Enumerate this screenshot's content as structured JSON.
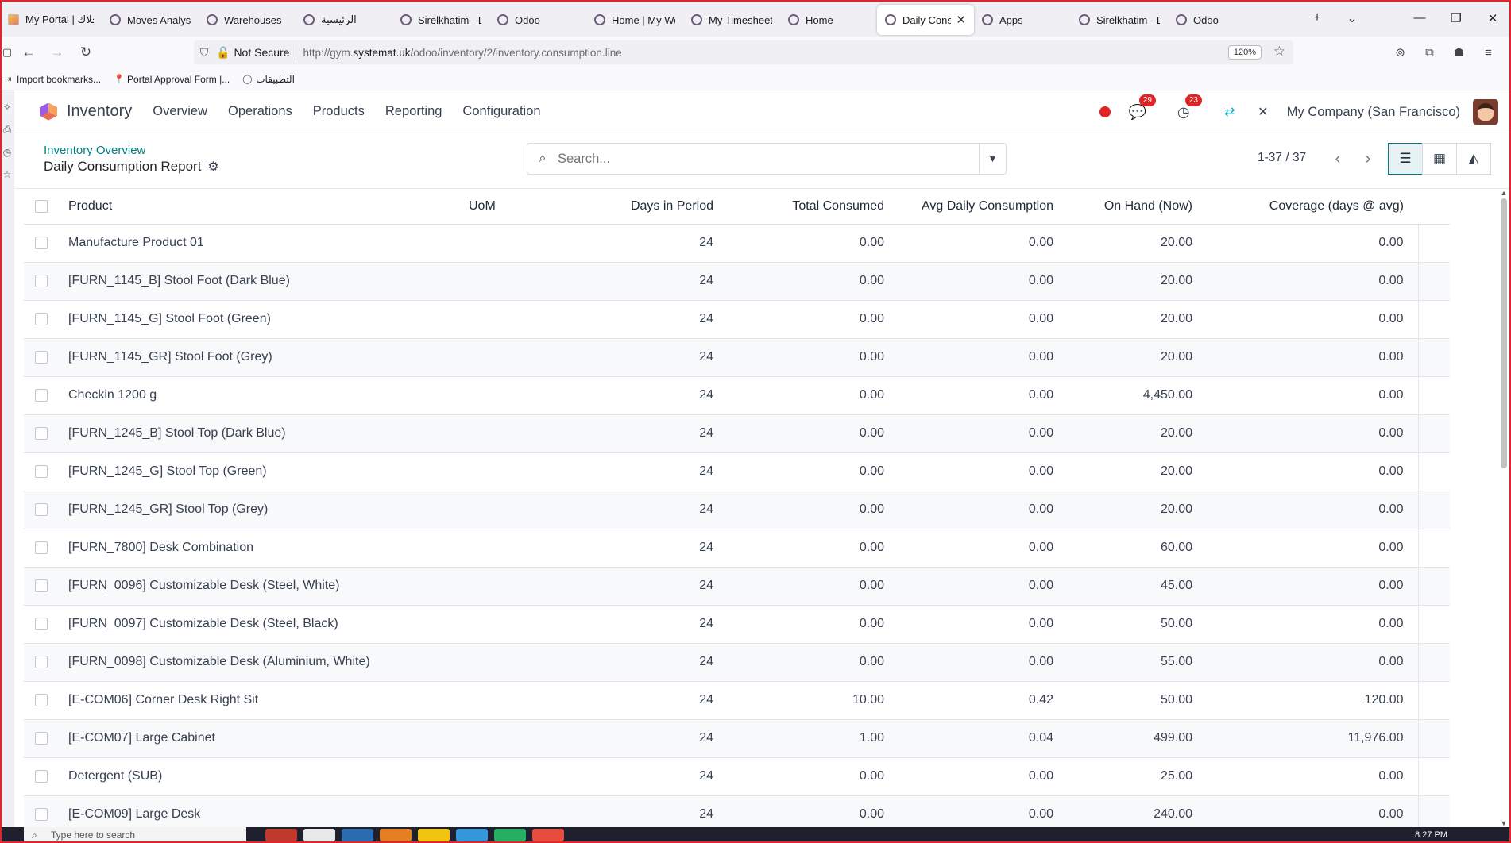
{
  "browser": {
    "tabs": [
      {
        "label": "My Portal | خلاك",
        "icon": "image-favicon"
      },
      {
        "label": "Moves Analysis",
        "icon": "odoo-circle-icon"
      },
      {
        "label": "Warehouses",
        "icon": "odoo-circle-icon"
      },
      {
        "label": "الرئيسية",
        "icon": "odoo-circle-icon"
      },
      {
        "label": "Sirelkhatim - D",
        "icon": "odoo-circle-icon"
      },
      {
        "label": "Odoo",
        "icon": "odoo-circle-icon"
      },
      {
        "label": "Home | My Wel",
        "icon": "odoo-circle-icon"
      },
      {
        "label": "My Timesheets",
        "icon": "odoo-circle-icon"
      },
      {
        "label": "Home",
        "icon": "odoo-circle-icon"
      },
      {
        "label": "Daily Consur",
        "icon": "odoo-circle-icon",
        "active": true
      },
      {
        "label": "Apps",
        "icon": "odoo-circle-icon"
      },
      {
        "label": "Sirelkhatim - D",
        "icon": "odoo-circle-icon"
      },
      {
        "label": "Odoo",
        "icon": "odoo-circle-icon"
      }
    ],
    "security_label": "Not Secure",
    "url_prefix": "http://gym.",
    "url_domain": "systemat.uk",
    "url_path": "/odoo/inventory/2/inventory.consumption.line",
    "zoom": "120%",
    "bookmarks": [
      {
        "label": "Import bookmarks...",
        "icon": "import-icon"
      },
      {
        "label": "Portal Approval Form |...",
        "icon": "pin-icon"
      },
      {
        "label": "التطبيقات",
        "icon": "odoo-circle-icon"
      }
    ]
  },
  "odoo": {
    "app_name": "Inventory",
    "menu": [
      "Overview",
      "Operations",
      "Products",
      "Reporting",
      "Configuration"
    ],
    "messages_count": "29",
    "activities_count": "23",
    "company": "My Company (San Francisco)",
    "breadcrumb": "Inventory Overview",
    "title": "Daily Consumption Report",
    "search_placeholder": "Search...",
    "pager": "1-37 / 37"
  },
  "table": {
    "headers": {
      "product": "Product",
      "uom": "UoM",
      "days": "Days in Period",
      "total": "Total Consumed",
      "avg": "Avg Daily Consumption",
      "onhand": "On Hand (Now)",
      "coverage": "Coverage (days @ avg)"
    },
    "rows": [
      {
        "product": "Manufacture Product 01",
        "uom": "",
        "days": "24",
        "total": "0.00",
        "avg": "0.00",
        "onhand": "20.00",
        "coverage": "0.00"
      },
      {
        "product": "[FURN_1145_B] Stool Foot (Dark Blue)",
        "uom": "",
        "days": "24",
        "total": "0.00",
        "avg": "0.00",
        "onhand": "20.00",
        "coverage": "0.00"
      },
      {
        "product": "[FURN_1145_G] Stool Foot (Green)",
        "uom": "",
        "days": "24",
        "total": "0.00",
        "avg": "0.00",
        "onhand": "20.00",
        "coverage": "0.00"
      },
      {
        "product": "[FURN_1145_GR] Stool Foot (Grey)",
        "uom": "",
        "days": "24",
        "total": "0.00",
        "avg": "0.00",
        "onhand": "20.00",
        "coverage": "0.00"
      },
      {
        "product": "Checkin 1200 g",
        "uom": "",
        "days": "24",
        "total": "0.00",
        "avg": "0.00",
        "onhand": "4,450.00",
        "coverage": "0.00"
      },
      {
        "product": "[FURN_1245_B] Stool Top (Dark Blue)",
        "uom": "",
        "days": "24",
        "total": "0.00",
        "avg": "0.00",
        "onhand": "20.00",
        "coverage": "0.00"
      },
      {
        "product": "[FURN_1245_G] Stool Top (Green)",
        "uom": "",
        "days": "24",
        "total": "0.00",
        "avg": "0.00",
        "onhand": "20.00",
        "coverage": "0.00"
      },
      {
        "product": "[FURN_1245_GR] Stool Top (Grey)",
        "uom": "",
        "days": "24",
        "total": "0.00",
        "avg": "0.00",
        "onhand": "20.00",
        "coverage": "0.00"
      },
      {
        "product": "[FURN_7800] Desk Combination",
        "uom": "",
        "days": "24",
        "total": "0.00",
        "avg": "0.00",
        "onhand": "60.00",
        "coverage": "0.00"
      },
      {
        "product": "[FURN_0096] Customizable Desk (Steel, White)",
        "uom": "",
        "days": "24",
        "total": "0.00",
        "avg": "0.00",
        "onhand": "45.00",
        "coverage": "0.00"
      },
      {
        "product": "[FURN_0097] Customizable Desk (Steel, Black)",
        "uom": "",
        "days": "24",
        "total": "0.00",
        "avg": "0.00",
        "onhand": "50.00",
        "coverage": "0.00"
      },
      {
        "product": "[FURN_0098] Customizable Desk (Aluminium, White)",
        "uom": "",
        "days": "24",
        "total": "0.00",
        "avg": "0.00",
        "onhand": "55.00",
        "coverage": "0.00"
      },
      {
        "product": "[E-COM06] Corner Desk Right Sit",
        "uom": "",
        "days": "24",
        "total": "10.00",
        "avg": "0.42",
        "onhand": "50.00",
        "coverage": "120.00"
      },
      {
        "product": "[E-COM07] Large Cabinet",
        "uom": "",
        "days": "24",
        "total": "1.00",
        "avg": "0.04",
        "onhand": "499.00",
        "coverage": "11,976.00"
      },
      {
        "product": "Detergent (SUB)",
        "uom": "",
        "days": "24",
        "total": "0.00",
        "avg": "0.00",
        "onhand": "25.00",
        "coverage": "0.00"
      },
      {
        "product": "[E-COM09] Large Desk",
        "uom": "",
        "days": "24",
        "total": "0.00",
        "avg": "0.00",
        "onhand": "240.00",
        "coverage": "0.00"
      }
    ]
  },
  "taskbar": {
    "search_placeholder": "Type here to search",
    "clock": "8:27 PM"
  },
  "colors": {
    "accent_teal": "#017e84",
    "badge_red": "#e02424",
    "frame_red": "#e0262b"
  }
}
